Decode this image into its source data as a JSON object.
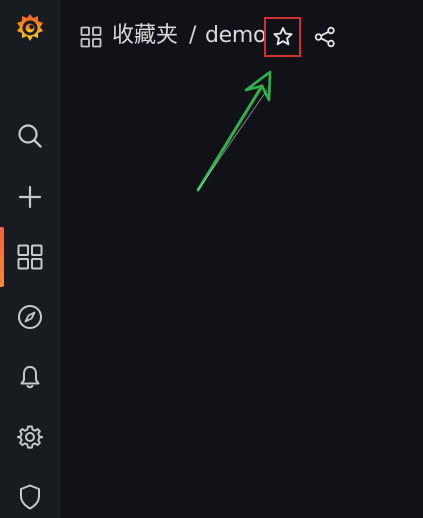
{
  "sidebar": {
    "logo": "grafana-logo",
    "items": [
      {
        "name": "search",
        "icon": "search-icon",
        "active": false
      },
      {
        "name": "create",
        "icon": "plus-icon",
        "active": false
      },
      {
        "name": "dashboards",
        "icon": "apps-grid-icon",
        "active": true
      },
      {
        "name": "explore",
        "icon": "compass-icon",
        "active": false
      },
      {
        "name": "alerting",
        "icon": "bell-icon",
        "active": false
      },
      {
        "name": "configuration",
        "icon": "gear-icon",
        "active": false
      },
      {
        "name": "server-admin",
        "icon": "shield-icon",
        "active": false
      }
    ]
  },
  "header": {
    "folder": "收藏夹",
    "separator": "/",
    "dashboard_title": "demo",
    "actions": {
      "star": "star-icon",
      "share": "share-icon"
    }
  },
  "annotation": {
    "box_color": "#d0312d",
    "arrow_color": "#2db34a"
  },
  "colors": {
    "background": "#111217",
    "sidebar": "#181b1f",
    "text": "#d8d9da",
    "icon": "#c7c9cc",
    "active_accent": "#f55f3e"
  }
}
